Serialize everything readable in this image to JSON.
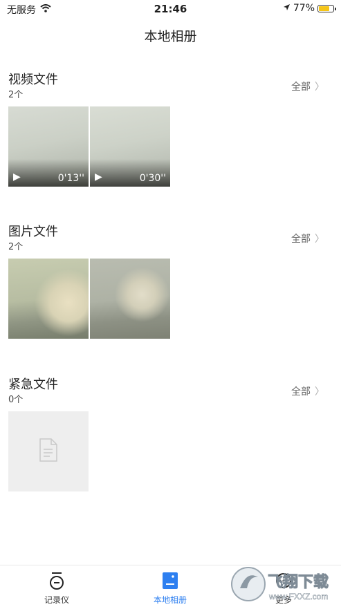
{
  "status_bar": {
    "carrier": "无服务",
    "time": "21:46",
    "battery": "77%",
    "battery_level": 0.77,
    "icons": [
      "wifi-icon",
      "location-arrow-icon",
      "battery-icon"
    ]
  },
  "nav": {
    "title": "本地相册"
  },
  "sections": [
    {
      "title": "视频文件",
      "count": "2个",
      "all_label": "全部",
      "items": [
        {
          "type": "video",
          "duration": "0'13''"
        },
        {
          "type": "video",
          "duration": "0'30''"
        }
      ]
    },
    {
      "title": "图片文件",
      "count": "2个",
      "all_label": "全部",
      "items": [
        {
          "type": "photo"
        },
        {
          "type": "photo"
        }
      ]
    },
    {
      "title": "紧急文件",
      "count": "0个",
      "all_label": "全部",
      "items": [
        {
          "type": "empty"
        }
      ]
    }
  ],
  "tab_bar": {
    "tabs": [
      {
        "label": "记录仪",
        "icon": "recorder-icon",
        "active": false
      },
      {
        "label": "本地相册",
        "icon": "album-icon",
        "active": true
      },
      {
        "label": "更多",
        "icon": "more-icon",
        "active": false
      }
    ]
  },
  "watermark": {
    "site": "飞翔下载",
    "url": "www.FXXZ.com"
  },
  "colors": {
    "accent": "#2d7ff0",
    "battery": "#f5c518"
  }
}
